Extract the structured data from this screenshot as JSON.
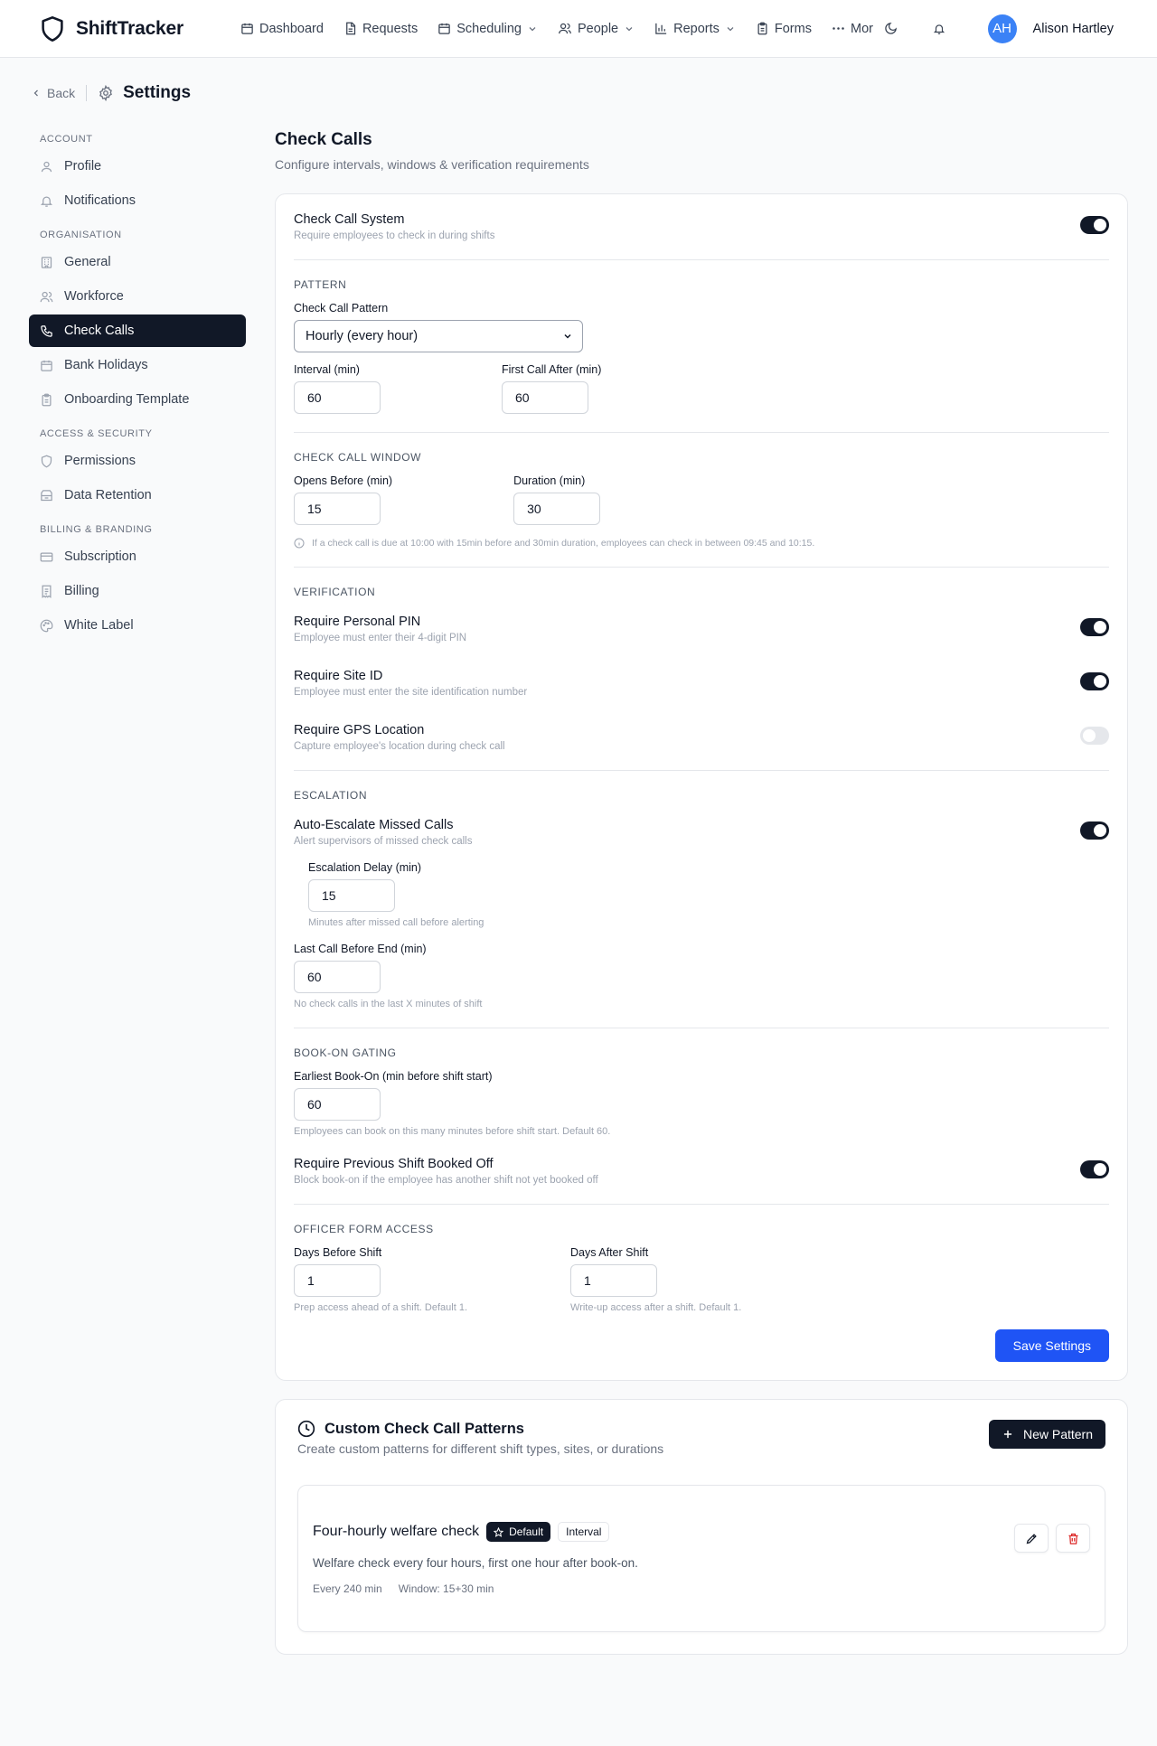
{
  "app": {
    "name": "ShiftTracker"
  },
  "nav": {
    "items": [
      {
        "label": "Dashboard",
        "icon": "calendar-icon"
      },
      {
        "label": "Requests",
        "icon": "file-icon"
      },
      {
        "label": "Scheduling",
        "icon": "calendar-icon",
        "dropdown": true
      },
      {
        "label": "People",
        "icon": "users-icon",
        "dropdown": true
      },
      {
        "label": "Reports",
        "icon": "bar-chart-icon",
        "dropdown": true
      },
      {
        "label": "Forms",
        "icon": "clipboard-icon"
      },
      {
        "label": "Mor",
        "icon": "more-icon"
      }
    ],
    "user": {
      "initials": "AH",
      "name": "Alison Hartley",
      "avatar_color": "#3b82f6"
    }
  },
  "sidebar": {
    "back_label": "Back",
    "title": "Settings",
    "sections": [
      {
        "label": "ACCOUNT",
        "items": [
          {
            "label": "Profile"
          },
          {
            "label": "Notifications"
          }
        ]
      },
      {
        "label": "ORGANISATION",
        "items": [
          {
            "label": "General"
          },
          {
            "label": "Workforce"
          },
          {
            "label": "Check Calls",
            "active": true
          },
          {
            "label": "Bank Holidays"
          },
          {
            "label": "Onboarding Template"
          }
        ]
      },
      {
        "label": "ACCESS & SECURITY",
        "items": [
          {
            "label": "Permissions"
          },
          {
            "label": "Data Retention"
          }
        ]
      },
      {
        "label": "BILLING & BRANDING",
        "items": [
          {
            "label": "Subscription"
          },
          {
            "label": "Billing"
          },
          {
            "label": "White Label"
          }
        ]
      }
    ]
  },
  "page": {
    "title": "Check Calls",
    "subtitle": "Configure intervals, windows & verification requirements"
  },
  "settings": {
    "system": {
      "title": "Check Call System",
      "desc": "Require employees to check in during shifts",
      "enabled": true
    },
    "pattern": {
      "section": "PATTERN",
      "pattern_label": "Check Call Pattern",
      "pattern_value": "Hourly (every hour)",
      "interval_label": "Interval (min)",
      "interval_value": "60",
      "first_call_label": "First Call After (min)",
      "first_call_value": "60"
    },
    "window": {
      "section": "CHECK CALL WINDOW",
      "opens_label": "Opens Before (min)",
      "opens_value": "15",
      "duration_label": "Duration (min)",
      "duration_value": "30",
      "info": "If a check call is due at 10:00 with 15min before and 30min duration, employees can check in between 09:45 and 10:15."
    },
    "verification": {
      "section": "VERIFICATION",
      "pin": {
        "title": "Require Personal PIN",
        "desc": "Employee must enter their 4-digit PIN",
        "enabled": true
      },
      "site": {
        "title": "Require Site ID",
        "desc": "Employee must enter the site identification number",
        "enabled": true
      },
      "gps": {
        "title": "Require GPS Location",
        "desc": "Capture employee's location during check call",
        "enabled": false
      }
    },
    "escalation": {
      "section": "ESCALATION",
      "auto": {
        "title": "Auto-Escalate Missed Calls",
        "desc": "Alert supervisors of missed check calls",
        "enabled": true
      },
      "delay_label": "Escalation Delay (min)",
      "delay_value": "15",
      "delay_hint": "Minutes after missed call before alerting",
      "last_label": "Last Call Before End (min)",
      "last_value": "60",
      "last_hint": "No check calls in the last X minutes of shift"
    },
    "bookon": {
      "section": "BOOK-ON GATING",
      "earliest_label": "Earliest Book-On (min before shift start)",
      "earliest_value": "60",
      "earliest_hint": "Employees can book on this many minutes before shift start. Default 60.",
      "prev": {
        "title": "Require Previous Shift Booked Off",
        "desc": "Block book-on if the employee has another shift not yet booked off",
        "enabled": true
      }
    },
    "officer": {
      "section": "OFFICER FORM ACCESS",
      "before_label": "Days Before Shift",
      "before_value": "1",
      "before_hint": "Prep access ahead of a shift. Default 1.",
      "after_label": "Days After Shift",
      "after_value": "1",
      "after_hint": "Write-up access after a shift. Default 1."
    },
    "save_label": "Save Settings"
  },
  "patterns": {
    "title": "Custom Check Call Patterns",
    "subtitle": "Create custom patterns for different shift types, sites, or durations",
    "new_label": "New Pattern",
    "items": [
      {
        "name": "Four-hourly welfare check",
        "badge_default": "Default",
        "badge_type": "Interval",
        "desc": "Welfare check every four hours, first one hour after book-on.",
        "meta_every": "Every 240 min",
        "meta_window": "Window: 15+30 min"
      }
    ]
  },
  "colors": {
    "primary": "#1f54f5",
    "dark": "#111827",
    "delete": "#dc2626"
  }
}
